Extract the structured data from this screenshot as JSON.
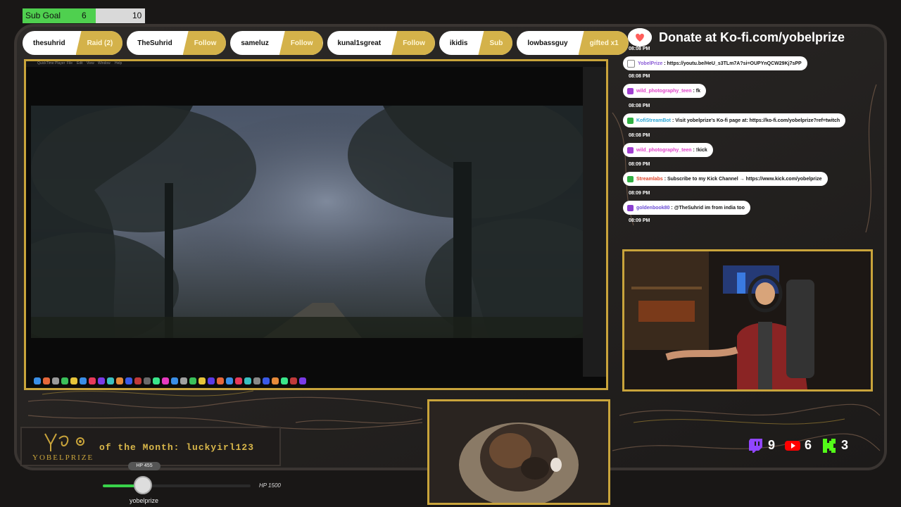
{
  "sub_goal": {
    "label": "Sub Goal",
    "current": "6",
    "target": "10",
    "progress": 0.6
  },
  "events": [
    {
      "name": "thesuhrid",
      "type": "Raid (2)"
    },
    {
      "name": "TheSuhrid",
      "type": "Follow"
    },
    {
      "name": "sameluz",
      "type": "Follow"
    },
    {
      "name": "kunal1sgreat",
      "type": "Follow"
    },
    {
      "name": "ikidis",
      "type": "Sub"
    },
    {
      "name": "lowbassguy",
      "type": "gifted x1"
    }
  ],
  "kofi": {
    "text": "Donate at Ko-fi.com/yobelprize",
    "icon": "kofi-cup-icon"
  },
  "chat": [
    {
      "time": "08:08 PM",
      "user": "YobelPrize",
      "text": "https://youtu.be/HeU_s3TLm7A?si=OUPYnQCW29Kj7sPP",
      "user_color": "#8a5bd6",
      "badge_color": "#ffffff"
    },
    {
      "time": "08:08 PM",
      "user": "wild_photography_teen",
      "text": "fk",
      "user_color": "#e040c8",
      "badge_color": "#a040d0"
    },
    {
      "time": "08:08 PM",
      "user": "KofiStreamBot",
      "text": "Visit yobelprize's Ko-fi page at: https://ko-fi.com/yobelprize?ref=twitch",
      "user_color": "#2aa6d6",
      "badge_color": "#31b043"
    },
    {
      "time": "08:08 PM",
      "user": "wild_photography_teen",
      "text": "!kick",
      "user_color": "#e040c8",
      "badge_color": "#a040d0"
    },
    {
      "time": "08:09 PM",
      "user": "Streamlabs",
      "text": "Subscribe to my Kick Channel → https://www.kick.com/yobelprize",
      "user_color": "#e0452a",
      "badge_color": "#31b043"
    },
    {
      "time": "08:09 PM",
      "user": "goldenbook80",
      "text": "@TheSuhrid im from india too",
      "user_color": "#6a4bd6",
      "badge_color": "#8a3fd0"
    }
  ],
  "chat_last_time": "08:09 PM",
  "screen": {
    "menu": [
      "QuickTime Player",
      "File",
      "Edit",
      "View",
      "Window",
      "Help"
    ]
  },
  "bottom": {
    "logo_word": "YOBELPRIZE",
    "sotm": "of the Month: luckyirl123",
    "hp_current": "HP 455",
    "hp_max": "HP 1500",
    "hp_fraction": 0.303,
    "username": "yobelprize"
  },
  "counts": [
    {
      "platform": "twitch-icon",
      "value": "9",
      "color": "#9146ff"
    },
    {
      "platform": "youtube-icon",
      "value": "6",
      "color": "#ff0000"
    },
    {
      "platform": "kick-icon",
      "value": "3",
      "color": "#53fc18"
    }
  ]
}
